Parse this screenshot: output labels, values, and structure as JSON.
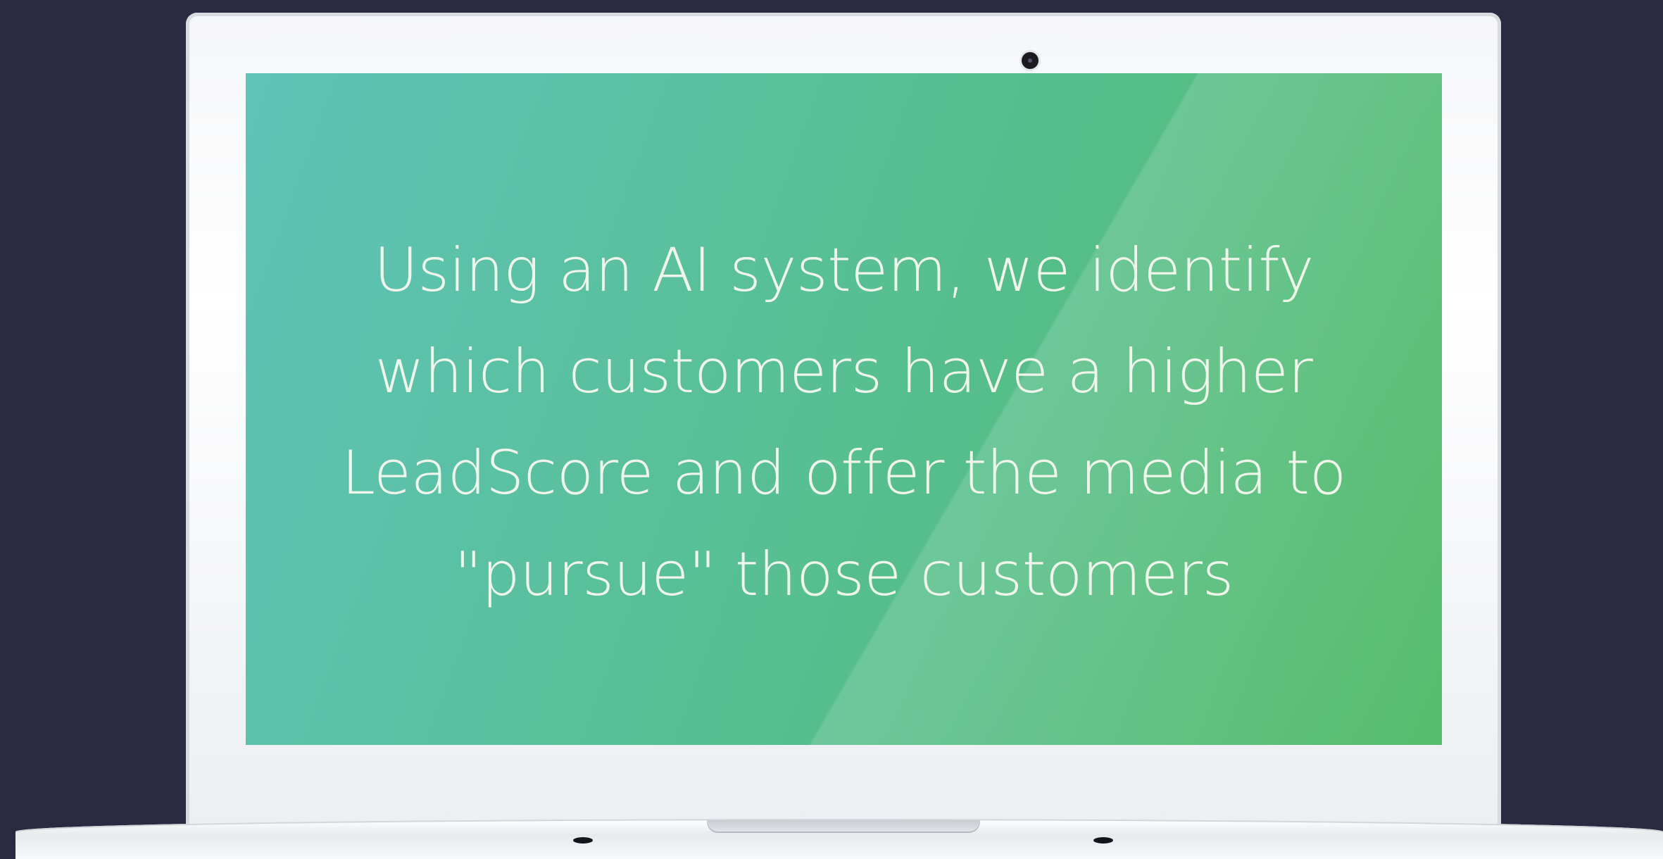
{
  "screen": {
    "message": "Using an AI system, we identify\nwhich customers have a higher\nLeadScore and offer the media to\n\"pursue\" those customers"
  },
  "colors": {
    "background": "#2a2a40",
    "screen_gradient_start": "#5fc3b8",
    "screen_gradient_end": "#4fba66",
    "text": "#f0f5ec",
    "laptop_frame": "#f5f6f8"
  },
  "icons": {
    "camera": "webcam-icon"
  }
}
